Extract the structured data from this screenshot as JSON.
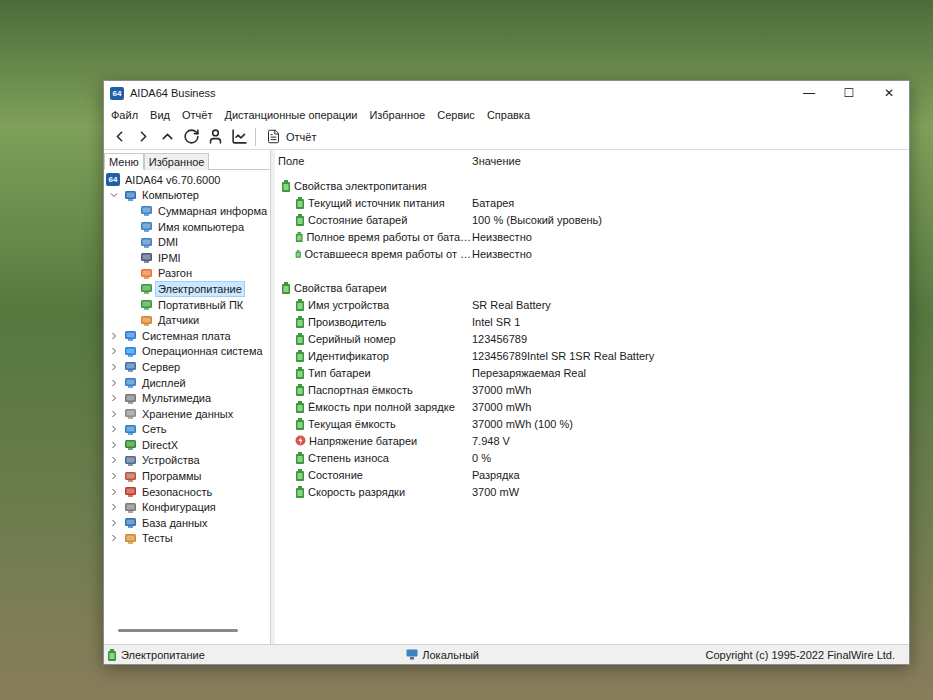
{
  "window": {
    "app_icon": "64",
    "title": "AIDA64 Business",
    "controls": [
      "—",
      "☐",
      "✕"
    ]
  },
  "menu": [
    "Файл",
    "Вид",
    "Отчёт",
    "Дистанционные операции",
    "Избранное",
    "Сервис",
    "Справка"
  ],
  "toolbar": {
    "report": "Отчёт"
  },
  "pane_tabs": [
    {
      "label": "Меню",
      "selected": true
    },
    {
      "label": "Избранное",
      "selected": false
    }
  ],
  "tree": [
    {
      "label": "AIDA64 v6.70.6000",
      "level": 0,
      "expandable": false,
      "expanded": false,
      "selected": false,
      "color": "#1f5fa8"
    },
    {
      "label": "Компьютер",
      "level": 1,
      "expandable": true,
      "expanded": true,
      "selected": false,
      "color": "#2a6fbf"
    },
    {
      "label": "Суммарная информа",
      "level": 2,
      "expandable": false,
      "expanded": false,
      "selected": false,
      "color": "#3b82c4"
    },
    {
      "label": "Имя компьютера",
      "level": 2,
      "expandable": false,
      "expanded": false,
      "selected": false,
      "color": "#3b82c4"
    },
    {
      "label": "DMI",
      "level": 2,
      "expandable": false,
      "expanded": false,
      "selected": false,
      "color": "#3b82c4"
    },
    {
      "label": "IPMI",
      "level": 2,
      "expandable": false,
      "expanded": false,
      "selected": false,
      "color": "#4a5a78"
    },
    {
      "label": "Разгон",
      "level": 2,
      "expandable": false,
      "expanded": false,
      "selected": false,
      "color": "#e8772e"
    },
    {
      "label": "Электропитание",
      "level": 2,
      "expandable": false,
      "expanded": false,
      "selected": true,
      "color": "#3a9a3a"
    },
    {
      "label": "Портативный ПК",
      "level": 2,
      "expandable": false,
      "expanded": false,
      "selected": false,
      "color": "#3a9a3a"
    },
    {
      "label": "Датчики",
      "level": 2,
      "expandable": false,
      "expanded": false,
      "selected": false,
      "color": "#d9822b"
    },
    {
      "label": "Системная плата",
      "level": 1,
      "expandable": true,
      "expanded": false,
      "selected": false,
      "color": "#2b7bd6"
    },
    {
      "label": "Операционная система",
      "level": 1,
      "expandable": true,
      "expanded": false,
      "selected": false,
      "color": "#1e88e5"
    },
    {
      "label": "Сервер",
      "level": 1,
      "expandable": true,
      "expanded": false,
      "selected": false,
      "color": "#3b6fb0"
    },
    {
      "label": "Дисплей",
      "level": 1,
      "expandable": true,
      "expanded": false,
      "selected": false,
      "color": "#2d7fc8"
    },
    {
      "label": "Мультимедиа",
      "level": 1,
      "expandable": true,
      "expanded": false,
      "selected": false,
      "color": "#777777"
    },
    {
      "label": "Хранение данных",
      "level": 1,
      "expandable": true,
      "expanded": false,
      "selected": false,
      "color": "#8a8a8a"
    },
    {
      "label": "Сеть",
      "level": 1,
      "expandable": true,
      "expanded": false,
      "selected": false,
      "color": "#2a7fd0"
    },
    {
      "label": "DirectX",
      "level": 1,
      "expandable": true,
      "expanded": false,
      "selected": false,
      "color": "#2e8b2e"
    },
    {
      "label": "Устройства",
      "level": 1,
      "expandable": true,
      "expanded": false,
      "selected": false,
      "color": "#4f6b8f"
    },
    {
      "label": "Программы",
      "level": 1,
      "expandable": true,
      "expanded": false,
      "selected": false,
      "color": "#b9553a"
    },
    {
      "label": "Безопасность",
      "level": 1,
      "expandable": true,
      "expanded": false,
      "selected": false,
      "color": "#c0392b"
    },
    {
      "label": "Конфигурация",
      "level": 1,
      "expandable": true,
      "expanded": false,
      "selected": false,
      "color": "#7a7a7a"
    },
    {
      "label": "База данных",
      "level": 1,
      "expandable": true,
      "expanded": false,
      "selected": false,
      "color": "#2f6fb8"
    },
    {
      "label": "Тесты",
      "level": 1,
      "expandable": true,
      "expanded": false,
      "selected": false,
      "color": "#d38b2c"
    }
  ],
  "table": {
    "columns": [
      "Поле",
      "Значение"
    ],
    "sections": [
      {
        "title": "Свойства электропитания",
        "rows": [
          {
            "field": "Текущий источник питания",
            "value": "Батарея",
            "kind": "battery"
          },
          {
            "field": "Состояние батарей",
            "value": "100 % (Высокий уровень)",
            "kind": "battery"
          },
          {
            "field": "Полное время работы от бата…",
            "value": "Неизвестно",
            "kind": "battery"
          },
          {
            "field": "Оставшееся время работы от …",
            "value": "Неизвестно",
            "kind": "battery"
          }
        ]
      },
      {
        "title": "Свойства батареи",
        "rows": [
          {
            "field": "Имя устройства",
            "value": "SR Real Battery",
            "kind": "battery"
          },
          {
            "field": "Производитель",
            "value": "Intel SR 1",
            "kind": "battery"
          },
          {
            "field": "Серийный номер",
            "value": "123456789",
            "kind": "battery"
          },
          {
            "field": "Идентификатор",
            "value": "123456789Intel SR 1SR Real Battery",
            "kind": "battery"
          },
          {
            "field": "Тип батареи",
            "value": "Перезаряжаемая Real",
            "kind": "battery"
          },
          {
            "field": "Паспортная ёмкость",
            "value": "37000 mWh",
            "kind": "battery"
          },
          {
            "field": "Ёмкость при полной зарядке",
            "value": "37000 mWh",
            "kind": "battery"
          },
          {
            "field": "Текущая ёмкость",
            "value": "37000 mWh  (100 %)",
            "kind": "battery"
          },
          {
            "field": "Напряжение батареи",
            "value": "7.948 V",
            "kind": "voltage"
          },
          {
            "field": "Степень износа",
            "value": "0 %",
            "kind": "battery"
          },
          {
            "field": "Состояние",
            "value": "Разрядка",
            "kind": "battery"
          },
          {
            "field": "Скорость разрядки",
            "value": "3700 mW",
            "kind": "battery"
          }
        ]
      }
    ]
  },
  "status_bar": {
    "left": "Электропитание",
    "middle": "Локальный",
    "right": "Copyright (c) 1995-2022 FinalWire Ltd."
  }
}
